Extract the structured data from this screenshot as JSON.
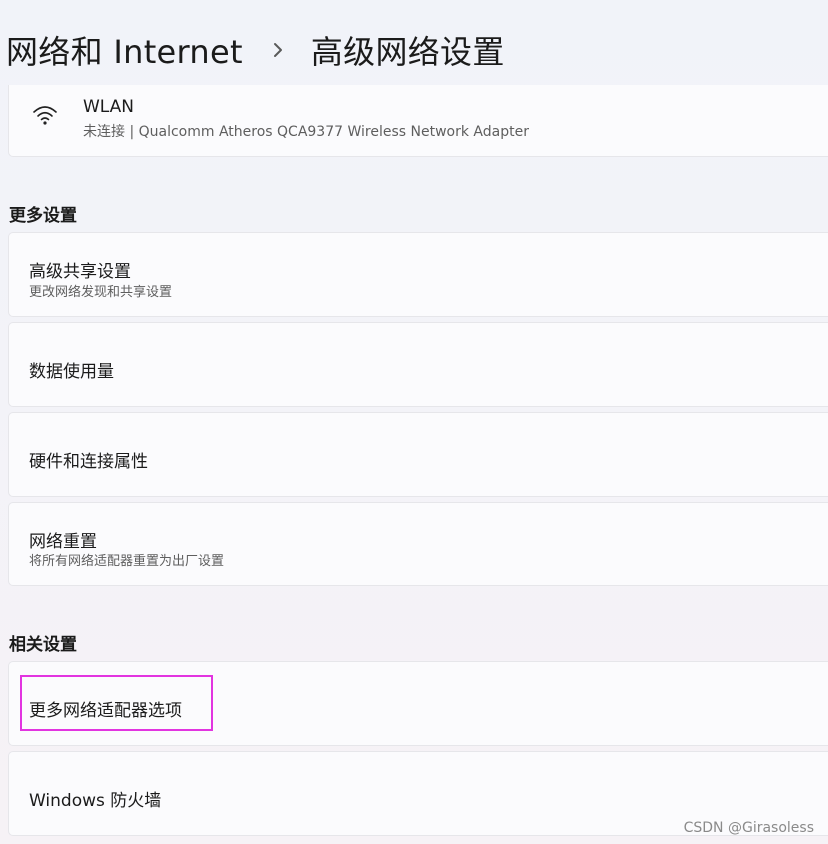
{
  "header": {
    "parent": "网络和 Internet",
    "separator_icon": "chevron-right-icon",
    "current": "高级网络设置"
  },
  "adapter": {
    "icon": "wifi-icon",
    "name": "WLAN",
    "status": "未连接 | Qualcomm Atheros QCA9377 Wireless Network Adapter"
  },
  "more_settings": {
    "label": "更多设置",
    "items": [
      {
        "title": "高级共享设置",
        "subtitle": "更改网络发现和共享设置"
      },
      {
        "title": "数据使用量"
      },
      {
        "title": "硬件和连接属性"
      },
      {
        "title": "网络重置",
        "subtitle": "将所有网络适配器重置为出厂设置"
      }
    ]
  },
  "related_settings": {
    "label": "相关设置",
    "items": [
      {
        "title": "更多网络适配器选项"
      },
      {
        "title": "Windows 防火墙"
      }
    ]
  },
  "highlight_color": "#e234e0",
  "watermark": "CSDN @Girasoless"
}
